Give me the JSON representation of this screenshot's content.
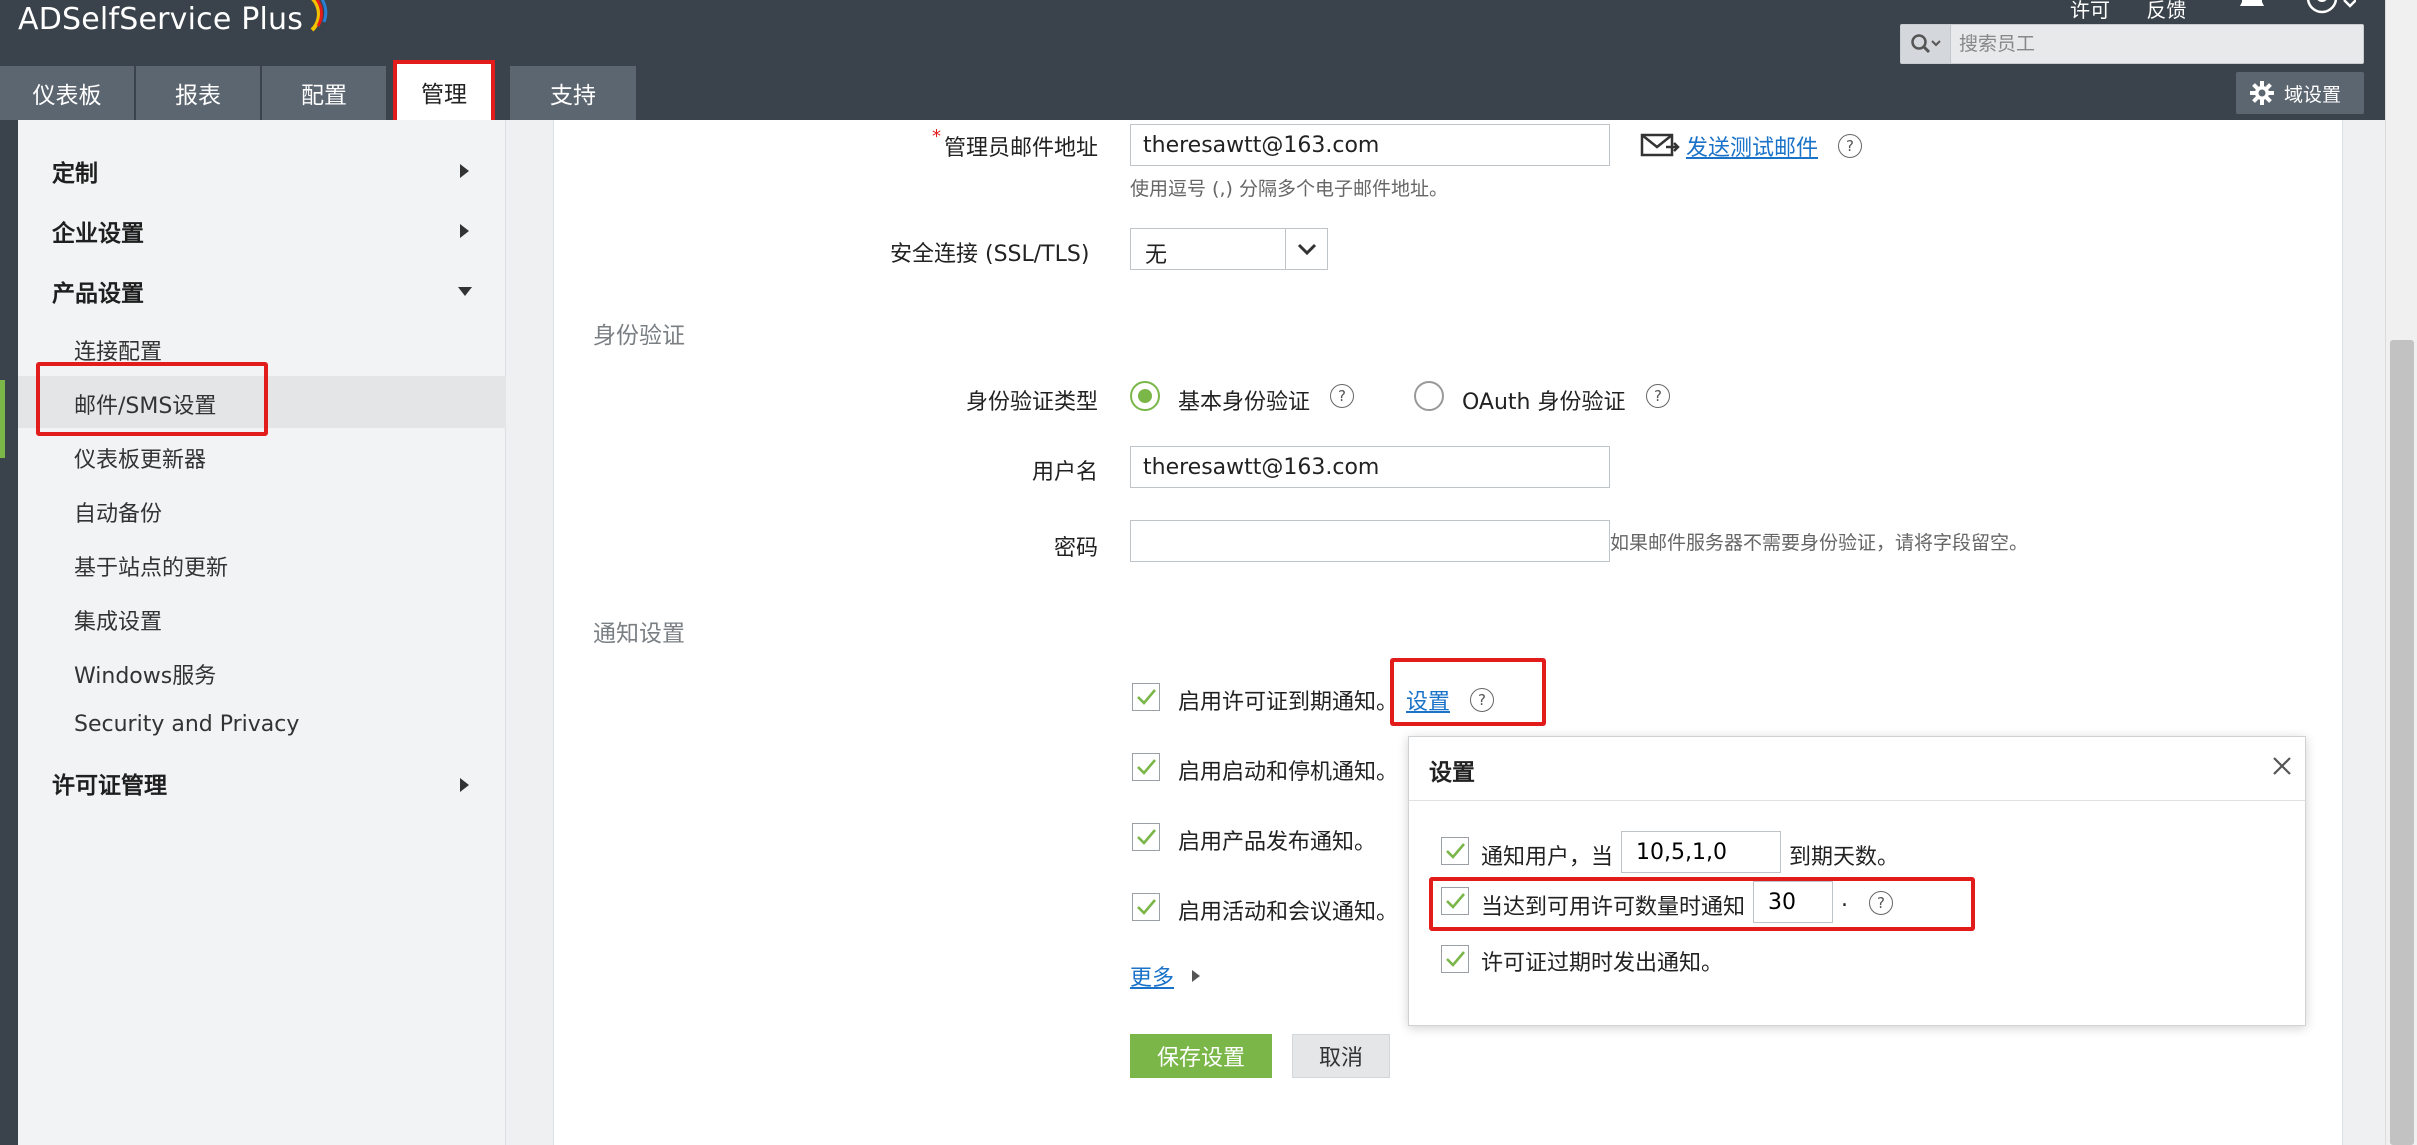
{
  "app": {
    "logo_text": "ADSelfService Plus",
    "top_links": [
      "许可",
      "反馈"
    ],
    "search_placeholder": "搜索员工",
    "domain_settings": "域设置"
  },
  "tabs": [
    "仪表板",
    "报表",
    "配置",
    "管理",
    "支持"
  ],
  "active_tab": "管理",
  "sidebar": {
    "sections": [
      {
        "label": "定制",
        "expanded": false
      },
      {
        "label": "企业设置",
        "expanded": false
      },
      {
        "label": "产品设置",
        "expanded": true
      },
      {
        "label": "许可证管理",
        "expanded": false
      }
    ],
    "product_items": [
      "连接配置",
      "邮件/SMS设置",
      "仪表板更新器",
      "自动备份",
      "基于站点的更新",
      "集成设置",
      "Windows服务",
      "Security and Privacy"
    ],
    "selected_item": "邮件/SMS设置"
  },
  "form": {
    "admin_email_label": "管理员邮件地址",
    "admin_email_value": "theresawtt@163.com",
    "send_test_mail": "发送测试邮件",
    "email_hint": "使用逗号 (,) 分隔多个电子邮件地址。",
    "secure_conn_label": "安全连接 (SSL/TLS)",
    "secure_conn_value": "无",
    "auth_section": "身份验证",
    "auth_type_label": "身份验证类型",
    "auth_basic": "基本身份验证",
    "auth_oauth": "OAuth 身份验证",
    "username_label": "用户名",
    "username_value": "theresawtt@163.com",
    "password_label": "密码",
    "password_hint": "如果邮件服务器不需要身份验证，请将字段留空。",
    "notify_section": "通知设置",
    "notify_license": "启用许可证到期通知。",
    "settings_link": "设置",
    "notify_startup": "启用启动和停机通知。",
    "notify_release": "启用产品发布通知。",
    "notify_events": "启用活动和会议通知。",
    "more_link": "更多",
    "save_button": "保存设置",
    "cancel_button": "取消"
  },
  "popup": {
    "title": "设置",
    "notify_users_prefix": "通知用户，当",
    "notify_days_value": "10,5,1,0",
    "notify_days_suffix": "到期天数。",
    "notify_count_label": "当达到可用许可数量时通知",
    "notify_count_value": "30",
    "notify_count_suffix": ".",
    "notify_expired": "许可证过期时发出通知。"
  },
  "colors": {
    "accent_green": "#7ab648",
    "highlight_red": "#e21b1b",
    "header_dark": "#3a434b",
    "link_blue": "#1a73c8"
  }
}
